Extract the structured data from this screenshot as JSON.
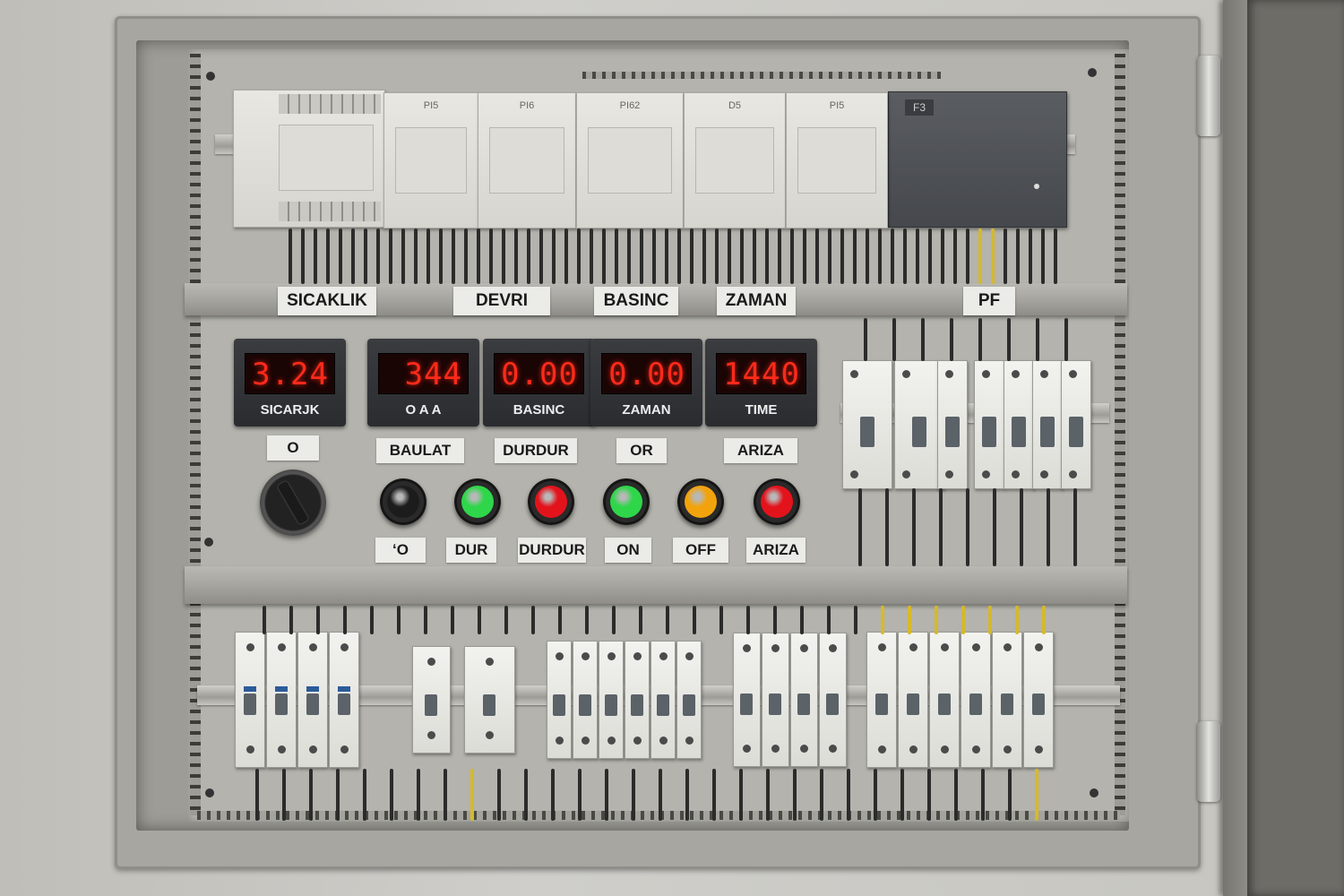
{
  "channel_labels": [
    "SICAKLIK",
    "DEVRI",
    "BASINC",
    "ZAMAN",
    "PF"
  ],
  "plc_modules": [
    "PI5",
    "PI6",
    "PI62",
    "D5",
    "PI5"
  ],
  "gateway_label": "F3",
  "meters": [
    {
      "value": "3.24",
      "caption": "SICARJK",
      "color": "#ff2a1a"
    },
    {
      "value": "344",
      "caption": "O A A",
      "color": "#ff2a1a"
    },
    {
      "value": "0.00",
      "caption": "BASINC",
      "color": "#ff2a1a"
    },
    {
      "value": "0.00",
      "caption": "ZAMAN",
      "color": "#ff2a1a"
    },
    {
      "value": "1440",
      "caption": "TIME",
      "color": "#ff2a1a"
    }
  ],
  "upper_tags": [
    "O",
    "BAULAT",
    "DURDUR",
    "OR",
    "ARIZA"
  ],
  "controls": [
    {
      "kind": "selector",
      "tag": ""
    },
    {
      "kind": "button",
      "color": "#1c1c1c",
      "tag": "ʻO"
    },
    {
      "kind": "button",
      "color": "#2fd64a",
      "tag": "DUR"
    },
    {
      "kind": "button",
      "color": "#e3131c",
      "tag": "DURDUR"
    },
    {
      "kind": "button",
      "color": "#2fd64a",
      "tag": "ON"
    },
    {
      "kind": "button",
      "color": "#f2a30c",
      "tag": "OFF"
    },
    {
      "kind": "button",
      "color": "#e3131c",
      "tag": "ARIZA"
    }
  ],
  "colors": {
    "enclosure": "#a7a6a0",
    "display": "#ff2a1a",
    "wire_yellow": "#d6b92a",
    "breaker_blue": "#2c5b9a"
  }
}
